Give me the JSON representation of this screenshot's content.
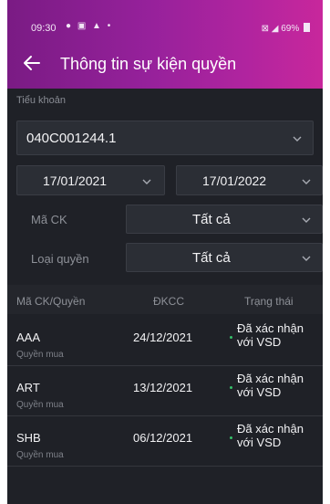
{
  "status_bar": {
    "time": "09:30",
    "left_icons": "● ▣ ▲ •",
    "right_text": "69%"
  },
  "header": {
    "title": "Thông tin sự kiện quyền"
  },
  "account": {
    "label": "Tiểu khoản",
    "value": "040C001244.1"
  },
  "date_range": {
    "from": "17/01/2021",
    "to": "17/01/2022"
  },
  "filters": {
    "symbol_label": "Mã CK",
    "symbol_value": "Tất cả",
    "right_type_label": "Loại quyền",
    "right_type_value": "Tất cả"
  },
  "table": {
    "headers": [
      "Mã CK/Quyền",
      "ĐKCC",
      "Trạng thái"
    ],
    "rows": [
      {
        "code": "AAA",
        "type": "Quyền mua",
        "date": "24/12/2021",
        "status_line1": "Đã xác nhận",
        "status_line2": "với VSD"
      },
      {
        "code": "ART",
        "type": "Quyền mua",
        "date": "13/12/2021",
        "status_line1": "Đã xác nhận",
        "status_line2": "với VSD"
      },
      {
        "code": "SHB",
        "type": "Quyền mua",
        "date": "06/12/2021",
        "status_line1": "Đã xác nhận",
        "status_line2": "với VSD"
      }
    ]
  },
  "colors": {
    "header_start": "#7a1b84",
    "header_end": "#c8279c",
    "background": "#1f2127",
    "status_dot": "#35c26a"
  },
  "icons": {
    "back": "arrow-left-icon",
    "dropdown": "chevron-down-icon"
  }
}
